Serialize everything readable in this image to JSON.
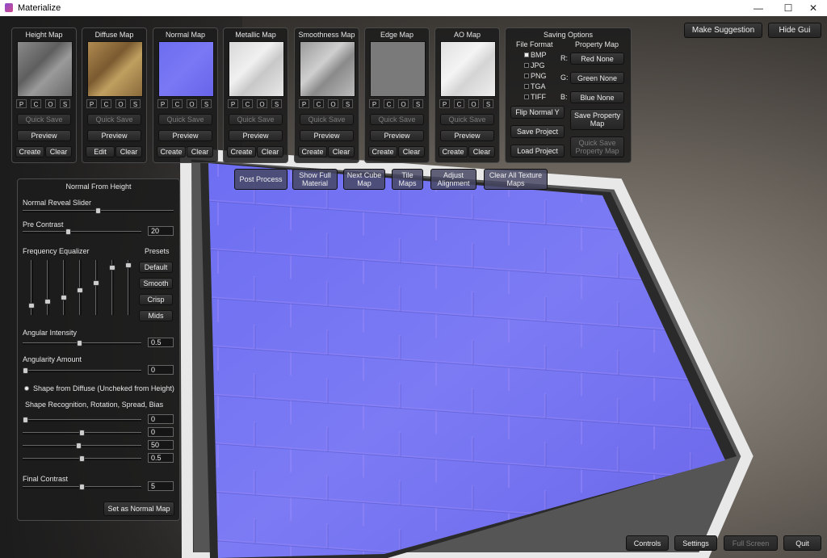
{
  "window": {
    "title": "Materialize",
    "minimize": "—",
    "maximize": "☐",
    "close": "✕"
  },
  "colors": {
    "normal_map": "#6a6ef0",
    "accent": "#5a5ed8",
    "panel": "#1c1c1c"
  },
  "maps": [
    {
      "title": "Height Map",
      "quick_save": "Quick Save",
      "preview": "Preview",
      "btn1": "Create",
      "btn2": "Clear",
      "pcos": [
        "P",
        "C",
        "O",
        "S"
      ]
    },
    {
      "title": "Diffuse Map",
      "quick_save": "Quick Save",
      "preview": "Preview",
      "btn1": "Edit",
      "btn2": "Clear",
      "pcos": [
        "P",
        "C",
        "O",
        "S"
      ]
    },
    {
      "title": "Normal Map",
      "quick_save": "Quick Save",
      "preview": "Preview",
      "btn1": "Create",
      "btn2": "Clear",
      "pcos": [
        "P",
        "C",
        "O",
        "S"
      ]
    },
    {
      "title": "Metallic Map",
      "quick_save": "Quick Save",
      "preview": "Preview",
      "btn1": "Create",
      "btn2": "Clear",
      "pcos": [
        "P",
        "C",
        "O",
        "S"
      ]
    },
    {
      "title": "Smoothness Map",
      "quick_save": "Quick Save",
      "preview": "Preview",
      "btn1": "Create",
      "btn2": "Clear",
      "pcos": [
        "P",
        "C",
        "O",
        "S"
      ]
    },
    {
      "title": "Edge Map",
      "quick_save": "Quick Save",
      "preview": "Preview",
      "btn1": "Create",
      "btn2": "Clear",
      "pcos": [
        "P",
        "C",
        "O",
        "S"
      ]
    },
    {
      "title": "AO Map",
      "quick_save": "Quick Save",
      "preview": "Preview",
      "btn1": "Create",
      "btn2": "Clear",
      "pcos": [
        "P",
        "C",
        "O",
        "S"
      ]
    }
  ],
  "saving": {
    "title": "Saving Options",
    "file_format_label": "File Format",
    "formats": [
      "BMP",
      "JPG",
      "PNG",
      "TGA",
      "TIFF"
    ],
    "selected_format": "BMP",
    "property_map_label": "Property Map",
    "channels": [
      {
        "label": "R:",
        "value": "Red None"
      },
      {
        "label": "G:",
        "value": "Green None"
      },
      {
        "label": "B:",
        "value": "Blue None"
      }
    ],
    "flip_normal": "Flip Normal Y",
    "save_project": "Save Project",
    "load_project": "Load Project",
    "save_property": "Save Property Map",
    "quick_save_property": "Quick Save Property Map"
  },
  "top_right": {
    "make_suggestion": "Make Suggestion",
    "hide_gui": "Hide Gui"
  },
  "toolbar": [
    "Post Process",
    "Show Full Material",
    "Next Cube Map",
    "Tile Maps",
    "Adjust Alignment",
    "Clear All Texture Maps"
  ],
  "nfh": {
    "title": "Normal From Height",
    "reveal_label": "Normal Reveal Slider",
    "reveal_value": 0.5,
    "pre_contrast_label": "Pre Contrast",
    "pre_contrast_value": "20",
    "pre_contrast_level": 0.38,
    "freq_label": "Frequency Equalizer",
    "presets_label": "Presets",
    "eq_levels": [
      0.15,
      0.22,
      0.3,
      0.45,
      0.6,
      0.9,
      0.95
    ],
    "presets": [
      "Default",
      "Smooth",
      "Crisp",
      "Mids"
    ],
    "angular_intensity_label": "Angular Intensity",
    "angular_intensity_value": "0.5",
    "angular_intensity_level": 0.48,
    "angularity_label": "Angularity Amount",
    "angularity_value": "0",
    "angularity_level": 0.0,
    "shape_diffuse_label": "Shape from Diffuse (Uncheked from Height)",
    "shape_recog_label": "Shape Recognition, Rotation, Spread, Bias",
    "shape_values": [
      "0",
      "0",
      "50",
      "0.5"
    ],
    "shape_levels": [
      0.0,
      0.5,
      0.47,
      0.5
    ],
    "final_contrast_label": "Final Contrast",
    "final_contrast_value": "5",
    "final_contrast_level": 0.5,
    "set_normal": "Set as Normal Map"
  },
  "bottom": {
    "controls": "Controls",
    "settings": "Settings",
    "full_screen": "Full Screen",
    "quit": "Quit"
  }
}
